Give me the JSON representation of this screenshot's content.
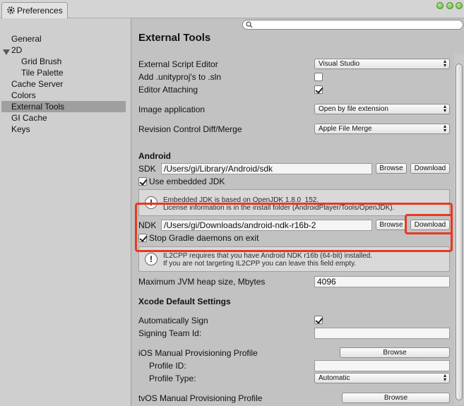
{
  "window": {
    "tab_title": "Preferences",
    "icon": "gear-icon"
  },
  "search": {
    "placeholder": "",
    "icon": "search-icon"
  },
  "sidebar": {
    "items": [
      {
        "label": "General"
      },
      {
        "label": "2D"
      },
      {
        "label": "Grid Brush"
      },
      {
        "label": "Tile Palette"
      },
      {
        "label": "Cache Server"
      },
      {
        "label": "Colors"
      },
      {
        "label": "External Tools",
        "selected": true
      },
      {
        "label": "GI Cache"
      },
      {
        "label": "Keys"
      }
    ]
  },
  "main": {
    "title": "External Tools",
    "script_editor": {
      "label": "External Script Editor",
      "value": "Visual Studio"
    },
    "add_unityproj": {
      "label": "Add .unityproj's to .sln",
      "checked": false
    },
    "editor_attaching": {
      "label": "Editor Attaching",
      "checked": true
    },
    "image_application": {
      "label": "Image application",
      "value": "Open by file extension"
    },
    "revision_control": {
      "label": "Revision Control Diff/Merge",
      "value": "Apple File Merge"
    },
    "android": {
      "heading": "Android",
      "sdk_label": "SDK",
      "sdk_path": "/Users/gi/Library/Android/sdk",
      "browse_label": "Browse",
      "download_label": "Download",
      "use_embedded_jdk": {
        "label": "Use embedded JDK",
        "checked": true
      },
      "jdk_info_line1": "Embedded JDK is based on OpenJDK 1.8.0_152.",
      "jdk_info_line2": "License information is in the install folder (AndroidPlayer/Tools/OpenJDK).",
      "ndk_label": "NDK",
      "ndk_path": "/Users/gi/Downloads/android-ndk-r16b-2",
      "ndk_browse_label": "Browse",
      "ndk_download_label": "Download",
      "stop_gradle": {
        "label": "Stop Gradle daemons on exit",
        "checked": true
      },
      "il2cpp_line1": "IL2CPP requires that you have Android NDK r16b (64-bit) installed.",
      "il2cpp_line2": "If you are not targeting IL2CPP you can leave this field empty.",
      "jvm_label": "Maximum JVM heap size, Mbytes",
      "jvm_value": "4096"
    },
    "xcode": {
      "heading": "Xcode Default Settings",
      "auto_sign": {
        "label": "Automatically Sign",
        "checked": true
      },
      "team_id_label": "Signing Team Id:",
      "team_id_value": "",
      "ios_profile_label": "iOS Manual Provisioning Profile",
      "ios_browse_label": "Browse",
      "profile_id_label": "Profile ID:",
      "profile_id_value": "",
      "profile_type_label": "Profile Type:",
      "profile_type_value": "Automatic",
      "tvos_profile_label": "tvOS Manual Provisioning Profile",
      "tvos_browse_label": "Browse"
    }
  },
  "colors": {
    "highlight": "#e53a22",
    "selected_bg": "#9f9f9f"
  }
}
